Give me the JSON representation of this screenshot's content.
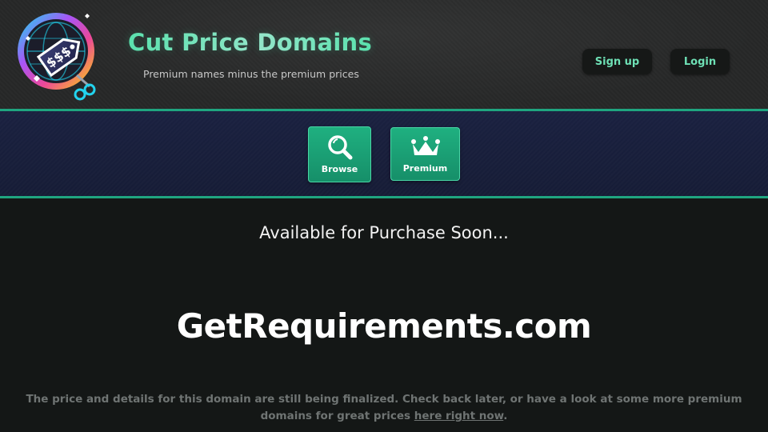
{
  "header": {
    "brand_title": "Cut Price Domains",
    "tagline": "Premium names minus the premium prices",
    "logo_icon": "price-tag-globe-scissors-icon",
    "signup_label": "Sign up",
    "login_label": "Login"
  },
  "nav": {
    "browse_label": "Browse",
    "browse_icon": "magnifier-icon",
    "premium_label": "Premium",
    "premium_icon": "crown-icon"
  },
  "main": {
    "availability": "Available for Purchase Soon...",
    "domain": "GetRequirements.com",
    "details_before": "The price and details for this domain are still being finalized. Check back later, or have a look at some more premium domains for great prices ",
    "details_link": "here right now",
    "details_after": "."
  },
  "colors": {
    "accent": "#1fa580",
    "button_text": "#6ee0b5",
    "nav_band": "#1a2140",
    "background": "#141716"
  }
}
